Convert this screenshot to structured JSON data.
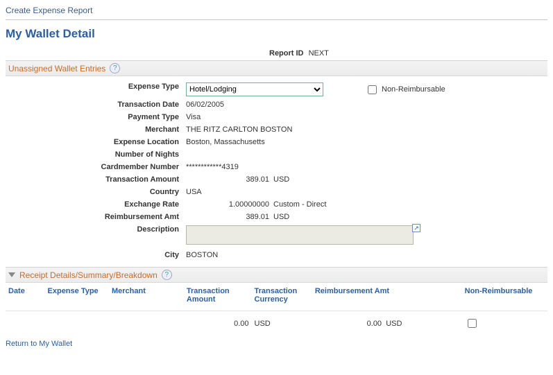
{
  "page_title": "Create Expense Report",
  "section_heading": "My Wallet Detail",
  "report_id_label": "Report ID",
  "report_id_value": "NEXT",
  "unassigned_bar": "Unassigned Wallet Entries",
  "form_labels": {
    "expense_type": "Expense Type",
    "non_reimbursable": "Non-Reimbursable",
    "transaction_date": "Transaction Date",
    "payment_type": "Payment Type",
    "merchant": "Merchant",
    "expense_location": "Expense Location",
    "number_of_nights": "Number of Nights",
    "cardmember_number": "Cardmember Number",
    "transaction_amount": "Transaction Amount",
    "country": "Country",
    "exchange_rate": "Exchange Rate",
    "reimbursement_amt": "Reimbursement Amt",
    "description": "Description",
    "city": "City"
  },
  "form_values": {
    "expense_type_selected": "Hotel/Lodging",
    "transaction_date": "06/02/2005",
    "payment_type": "Visa",
    "merchant": "THE RITZ CARLTON BOSTON",
    "expense_location": "Boston, Massachusetts",
    "number_of_nights": "",
    "cardmember_number": "************4319",
    "transaction_amount": "389.01",
    "transaction_currency": "USD",
    "country": "USA",
    "exchange_rate": "1.00000000",
    "exchange_rate_note": "Custom - Direct",
    "reimbursement_amt": "389.01",
    "reimbursement_currency": "USD",
    "description": "",
    "city": "BOSTON",
    "non_reimbursable_checked": false
  },
  "collapse_bar": "Receipt Details/Summary/Breakdown",
  "grid": {
    "headers": {
      "date": "Date",
      "expense_type": "Expense Type",
      "merchant": "Merchant",
      "txn_amount": "Transaction Amount",
      "txn_currency": "Transaction Currency",
      "reimb_amt": "Reimbursement Amt",
      "non_reimb": "Non-Reimbursable"
    },
    "row": {
      "date": "",
      "expense_type": "",
      "merchant": "",
      "txn_amount": "0.00",
      "txn_currency": "USD",
      "reimb_amt": "0.00",
      "reimb_currency": "USD",
      "non_reimb_checked": false
    }
  },
  "return_link": "Return to My Wallet"
}
